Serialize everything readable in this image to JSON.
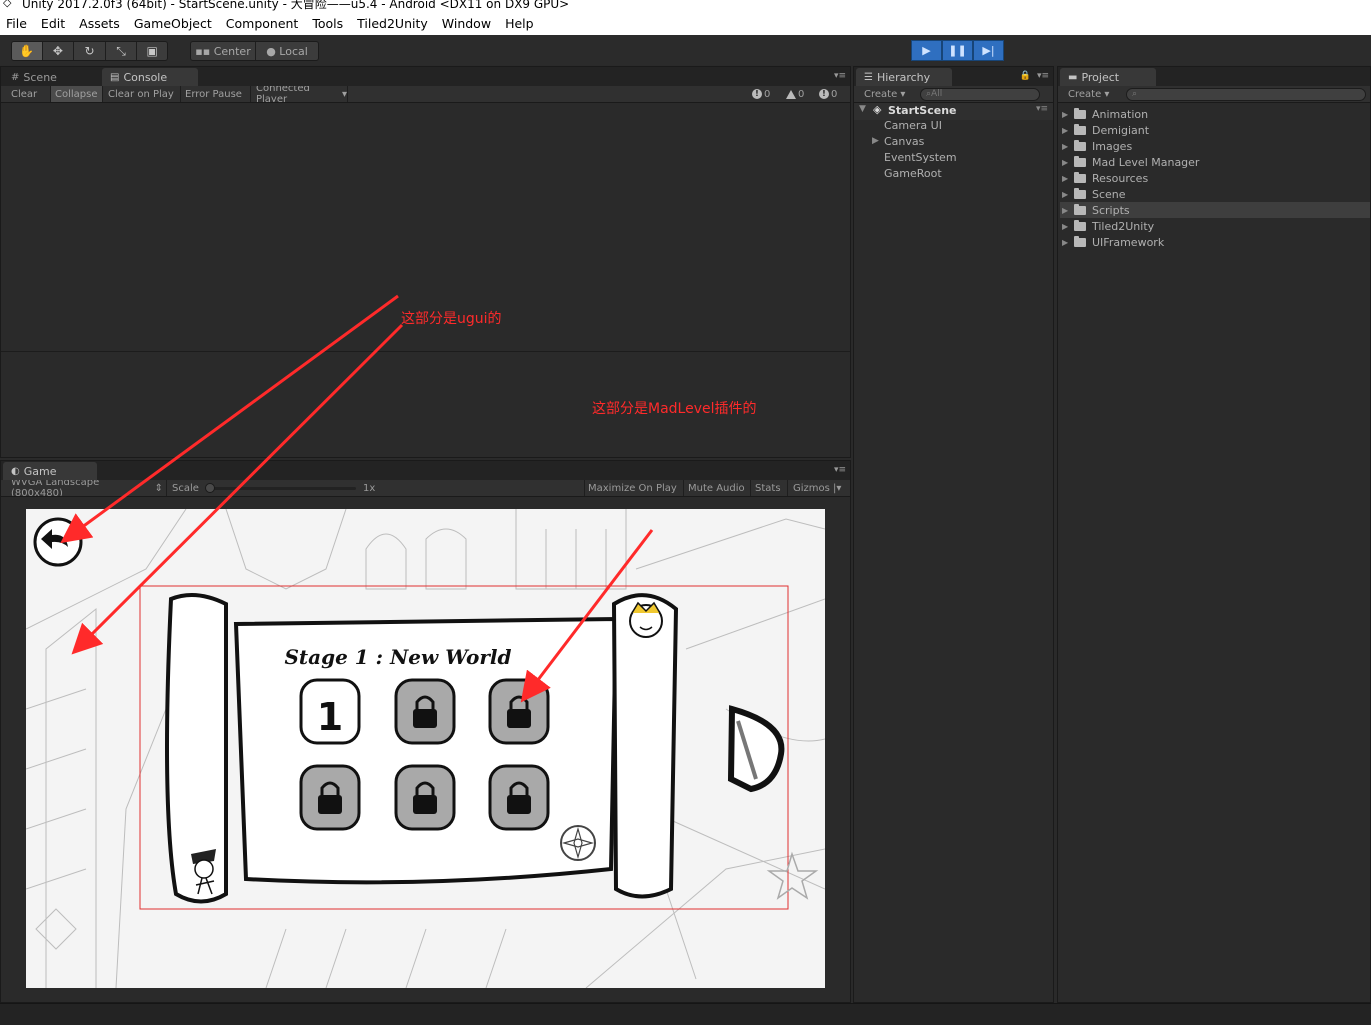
{
  "window": {
    "title": "Unity 2017.2.0f3 (64bit) - StartScene.unity - 大冒险——u5.4 - Android <DX11 on DX9 GPU>"
  },
  "menu": [
    "File",
    "Edit",
    "Assets",
    "GameObject",
    "Component",
    "Tools",
    "Tiled2Unity",
    "Window",
    "Help"
  ],
  "toolbar": {
    "tools": [
      "hand-tool",
      "move-tool",
      "rotate-tool",
      "scale-tool",
      "rect-tool"
    ],
    "pivot_center": "Center",
    "pivot_local": "Local",
    "play": "play",
    "pause": "pause",
    "step": "step"
  },
  "console_panel": {
    "tabs": [
      "Scene",
      "Console"
    ],
    "buttons": [
      "Clear",
      "Collapse",
      "Clear on Play",
      "Error Pause",
      "Connected Player"
    ],
    "counts": {
      "info": "0",
      "warning": "0",
      "error": "0"
    }
  },
  "game_panel": {
    "tab": "Game",
    "resolution": "WVGA Landscape (800x480)",
    "scale_label": "Scale",
    "scale_value": "1x",
    "options": [
      "Maximize On Play",
      "Mute Audio",
      "Stats",
      "Gizmos"
    ]
  },
  "game_content": {
    "stage_title": "Stage 1  :  New World",
    "level_1": "1",
    "back_icon": "back-arrow-icon"
  },
  "hierarchy": {
    "tab": "Hierarchy",
    "create": "Create",
    "search_placeholder": "All",
    "scene": "StartScene",
    "items": [
      "Camera UI",
      "Canvas",
      "EventSystem",
      "GameRoot"
    ]
  },
  "project": {
    "tab": "Project",
    "create": "Create",
    "folders": [
      "Animation",
      "Demigiant",
      "Images",
      "Mad Level Manager",
      "Resources",
      "Scene",
      "Scripts",
      "Tiled2Unity",
      "UIFramework"
    ],
    "selected": "Scripts"
  },
  "annotations": {
    "ugui": "这部分是ugui的",
    "madlevel": "这部分是MadLevel插件的"
  },
  "colors": {
    "annotation": "#ff2a2a",
    "play_active": "#2f6fc0"
  }
}
